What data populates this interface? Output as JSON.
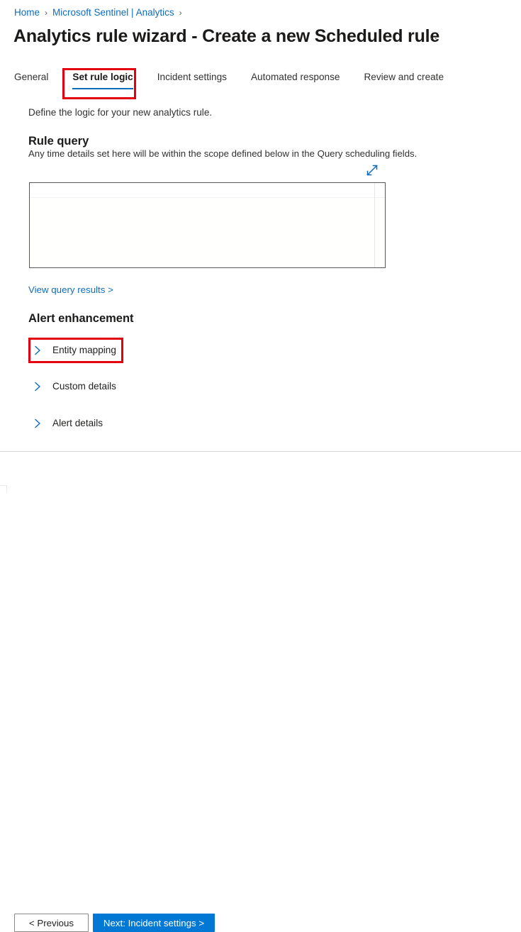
{
  "breadcrumb": {
    "separator": "›",
    "items": [
      {
        "label": "Home"
      },
      {
        "label": "Microsoft Sentinel | Analytics"
      }
    ]
  },
  "header": {
    "title": "Analytics rule wizard - Create a new Scheduled rule",
    "more_menu": "···"
  },
  "tabs": [
    {
      "label": "General",
      "selected": false
    },
    {
      "label": "Set rule logic",
      "selected": true
    },
    {
      "label": "Incident settings",
      "selected": false
    },
    {
      "label": "Automated response",
      "selected": false
    },
    {
      "label": "Review and create",
      "selected": false
    }
  ],
  "main": {
    "intro": "Define the logic for your new analytics rule.",
    "rule_query": {
      "heading": "Rule query",
      "subtext": "Any time details set here will be within the scope defined below in the Query scheduling fields.",
      "expand_icon": "expand-diagonal-icon",
      "editor_value": "",
      "editor_placeholder": ""
    },
    "view_results_link": "View query results >",
    "alert_enhancement": {
      "heading": "Alert enhancement",
      "rows": [
        {
          "label": "Entity mapping",
          "icon": "chevron-right-icon",
          "expanded": false
        },
        {
          "label": "Custom details",
          "icon": "chevron-right-icon",
          "expanded": false
        },
        {
          "label": "Alert details",
          "icon": "chevron-right-icon",
          "expanded": false
        }
      ]
    }
  },
  "footer": {
    "previous_label": "< Previous",
    "next_label": "Next: Incident settings >"
  },
  "annotations": [
    {
      "name": "tab-set-rule-logic-highlight",
      "color": "#e3000f"
    },
    {
      "name": "entity-mapping-highlight",
      "color": "#e3000f"
    }
  ],
  "colors": {
    "accent_blue": "#0078d4",
    "link_blue": "#0f6cbd",
    "annotation_red": "#e3000f",
    "text_primary": "#201f1e"
  }
}
